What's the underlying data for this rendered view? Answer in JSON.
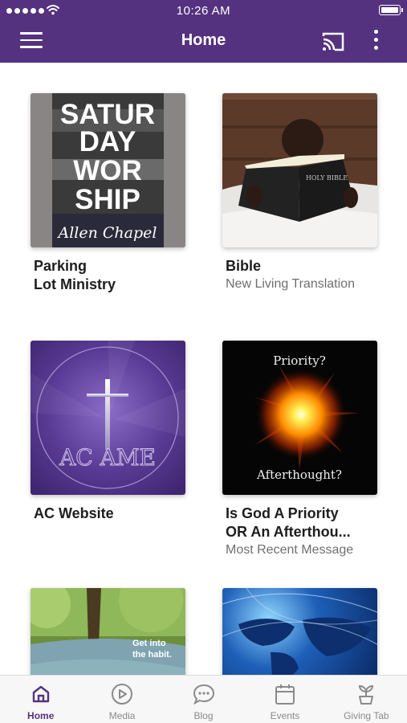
{
  "status_bar": {
    "time": "10:26 AM",
    "signal_icon": "signal-dots-icon",
    "wifi_icon": "wifi-icon",
    "battery_icon": "battery-icon"
  },
  "header": {
    "title": "Home",
    "menu_icon": "hamburger-menu-icon",
    "cast_icon": "cast-icon",
    "more_icon": "more-vertical-icon",
    "background": "#55327f"
  },
  "cards": [
    {
      "title_line1": "Parking",
      "title_line2": "Lot Ministry",
      "subtitle": "",
      "image_text_lines": [
        "SATUR",
        "DAY",
        "WOR",
        "SHIP"
      ],
      "image_script": "Allen Chapel"
    },
    {
      "title_line1": "Bible",
      "title_line2": "",
      "subtitle": "New Living Translation",
      "image_book_text": "HOLY BIBLE"
    },
    {
      "title_line1": "AC Website",
      "title_line2": "",
      "subtitle": "",
      "image_text": "AC AME"
    },
    {
      "title_line1": "Is God A Priority",
      "title_line2": "OR An Afterthou...",
      "subtitle": "Most Recent Message",
      "image_top_text": "Priority?",
      "image_bottom_text": "Afterthought?"
    },
    {
      "title_line1": "",
      "title_line2": "",
      "subtitle": "",
      "image_text_line1": "Get into",
      "image_text_line2": "the habit."
    },
    {
      "title_line1": "",
      "title_line2": "",
      "subtitle": ""
    }
  ],
  "tabs": [
    {
      "label": "Home",
      "icon": "home-icon",
      "active": true
    },
    {
      "label": "Media",
      "icon": "play-circle-icon",
      "active": false
    },
    {
      "label": "Blog",
      "icon": "chat-bubble-icon",
      "active": false
    },
    {
      "label": "Events",
      "icon": "calendar-icon",
      "active": false
    },
    {
      "label": "Giving Tab",
      "icon": "plant-sprout-icon",
      "active": false
    }
  ],
  "colors": {
    "accent": "#55327f",
    "tab_inactive": "#8a8a8a",
    "subtitle": "#6f6f6f"
  }
}
